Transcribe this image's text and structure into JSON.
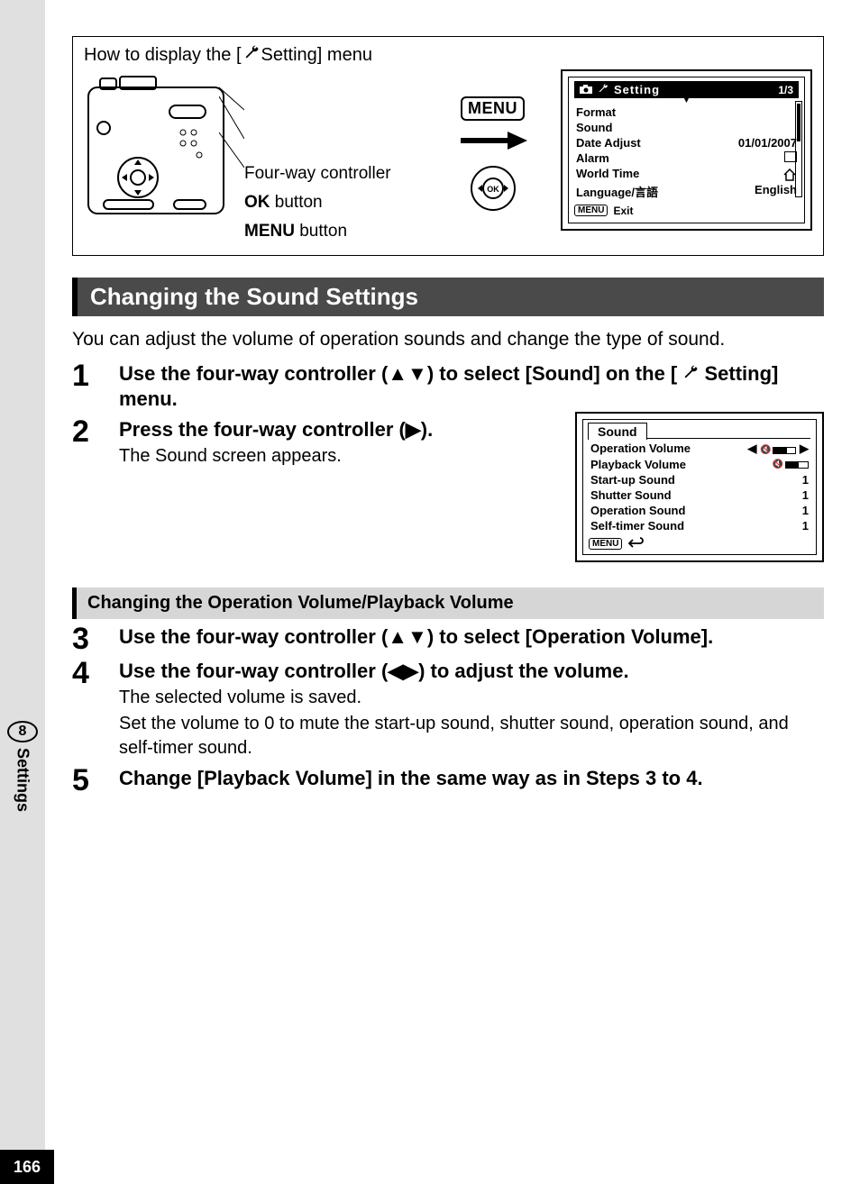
{
  "page_number": "166",
  "side_tab": {
    "chapter": "8",
    "label": "Settings"
  },
  "top_box": {
    "title_prefix": "How to display the [",
    "title_suffix": " Setting] menu",
    "controller_label": "Four-way controller",
    "ok_label": "OK",
    "ok_suffix": "  button",
    "menu_btn_label": "MENU",
    "menu_btn_suffix": " button",
    "menu_chip": "MENU",
    "ok_chip": "OK"
  },
  "lcd": {
    "header_title": "Setting",
    "page_indicator": "1/3",
    "rows": [
      {
        "label": "Format",
        "value": ""
      },
      {
        "label": "Sound",
        "value": ""
      },
      {
        "label": "Date Adjust",
        "value": "01/01/2007"
      },
      {
        "label": "Alarm",
        "value": ""
      },
      {
        "label": "World Time",
        "value": ""
      },
      {
        "label": "Language/言語",
        "value": "English"
      }
    ],
    "footer_menu": "MENU",
    "footer_exit": "Exit"
  },
  "section_title": "Changing the Sound Settings",
  "intro": "You can adjust the volume of operation sounds and change the type of sound.",
  "steps_initial": {
    "s1_head": "Use the four-way controller (▲▼) to select [Sound] on the [",
    "s1_head_suffix": "Setting] menu.",
    "s2_head": "Press the four-way controller (▶).",
    "s2_sub": "The Sound screen appears."
  },
  "sound_screen": {
    "tab": "Sound",
    "rows": [
      {
        "label": "Operation Volume",
        "value": ""
      },
      {
        "label": "Playback Volume",
        "value": ""
      },
      {
        "label": "Start-up Sound",
        "value": "1"
      },
      {
        "label": "Shutter Sound",
        "value": "1"
      },
      {
        "label": "Operation Sound",
        "value": "1"
      },
      {
        "label": "Self-timer Sound",
        "value": "1"
      }
    ],
    "footer_menu": "MENU"
  },
  "sub_heading": "Changing the Operation Volume/Playback Volume",
  "steps_3to5": {
    "s3_head": "Use the four-way controller (▲▼) to select [Operation Volume].",
    "s4_head": "Use the four-way controller (◀▶) to adjust the volume.",
    "s4_sub1": "The selected volume is saved.",
    "s4_sub2": "Set the volume to 0 to mute the start-up sound, shutter sound, operation sound, and self-timer sound.",
    "s5_head": "Change [Playback Volume] in the same way as in Steps 3 to 4."
  }
}
